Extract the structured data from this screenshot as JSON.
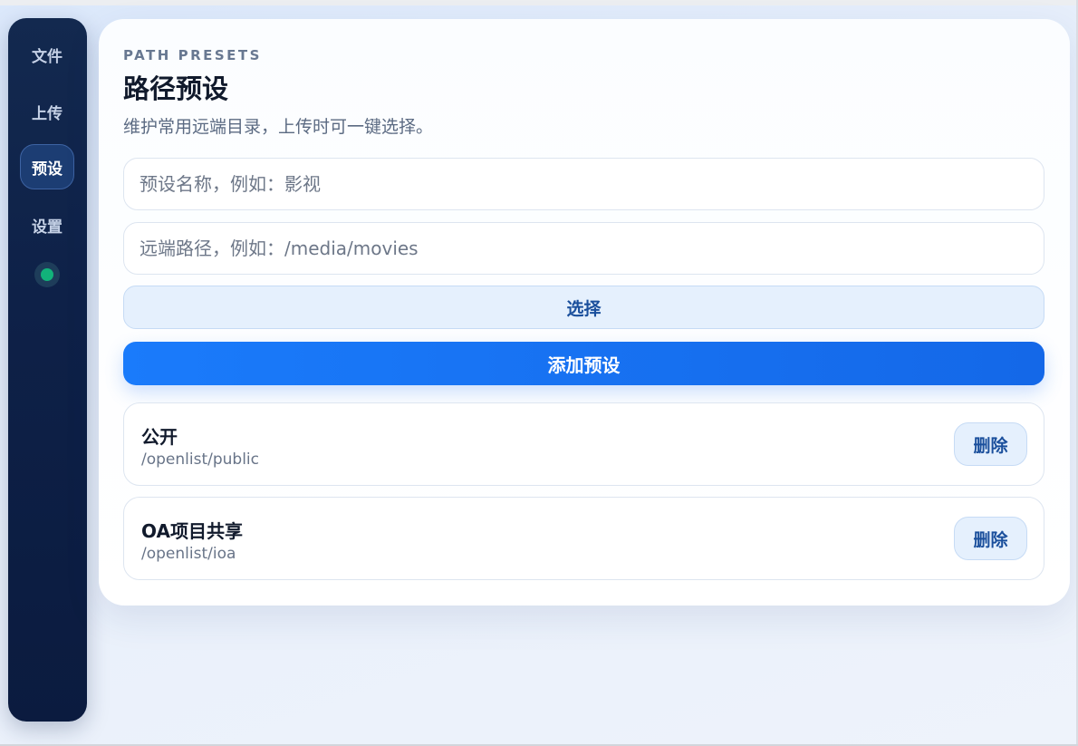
{
  "sidebar": {
    "items": [
      {
        "label": "文件",
        "active": false
      },
      {
        "label": "上传",
        "active": false
      },
      {
        "label": "预设",
        "active": true
      },
      {
        "label": "设置",
        "active": false
      }
    ],
    "status_color": "#12b27a"
  },
  "main": {
    "eyebrow": "PATH PRESETS",
    "title": "路径预设",
    "subtitle": "维护常用远端目录，上传时可一键选择。",
    "form": {
      "name_value": "",
      "name_placeholder": "预设名称，例如：影视",
      "path_value": "",
      "path_placeholder": "远端路径，例如：/media/movies",
      "select_label": "选择",
      "add_label": "添加预设"
    },
    "presets": [
      {
        "name": "公开",
        "path": "/openlist/public",
        "delete_label": "删除"
      },
      {
        "name": "OA项目共享",
        "path": "/openlist/ioa",
        "delete_label": "删除"
      }
    ]
  },
  "colors": {
    "accent": "#1a7bfb",
    "sidebar_bg": "#0e2148",
    "button_soft": "#e5f0fd"
  }
}
